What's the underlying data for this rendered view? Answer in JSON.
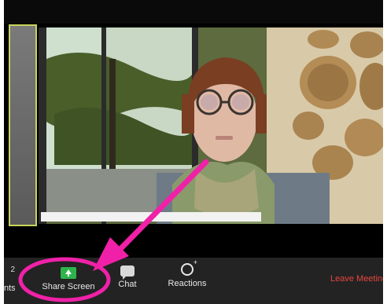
{
  "toolbar": {
    "participants_count": "2",
    "participants_label": "nts",
    "share_label": "Share Screen",
    "chat_label": "Chat",
    "reactions_label": "Reactions",
    "leave_label": "Leave Meeting"
  },
  "colors": {
    "share_icon": "#2db44b",
    "leave_text": "#e8473d",
    "annotation": "#f021a8",
    "active_border": "#c9d45a"
  },
  "icons": {
    "share": "share-screen-icon",
    "chat": "chat-bubble-icon",
    "reactions": "reaction-smiley-icon"
  }
}
